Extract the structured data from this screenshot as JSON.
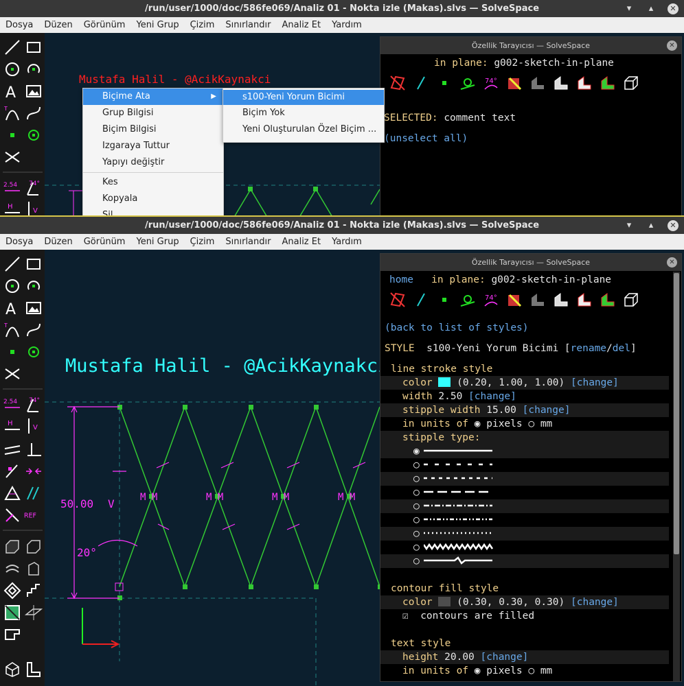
{
  "window_title": "/run/user/1000/doc/586fe069/Analiz 01 - Nokta izle (Makas).slvs — SolveSpace",
  "window_buttons": {
    "minimize": "▾",
    "maximize": "▴",
    "close": "✕"
  },
  "menu": [
    "Dosya",
    "Düzen",
    "Görünüm",
    "Yeni Grup",
    "Çizim",
    "Sınırlandır",
    "Analiz Et",
    "Yardım"
  ],
  "comment_text": "Mustafa Halil - @AcikKaynakci",
  "constraint_labels": {
    "length": "50.00",
    "angle": "20°",
    "vertical": "V",
    "midpoint": "M",
    "ref": "REF",
    "dim": "2.54",
    "deg": "74°",
    "h": "H",
    "v": "V"
  },
  "top": {
    "context_menu": [
      {
        "label": "Biçime Ata",
        "submenu": true
      },
      {
        "label": "Grup Bilgisi"
      },
      {
        "label": "Biçim Bilgisi"
      },
      {
        "label": "Izgaraya Tuttur"
      },
      {
        "label": "Yapıyı değiştir"
      },
      {
        "label": "Kes"
      },
      {
        "label": "Kopyala"
      },
      {
        "label": "Sil"
      }
    ],
    "submenu": [
      "s100-Yeni Yorum Bicimi",
      "Biçim Yok",
      "Yeni Oluşturulan Özel Biçim ..."
    ],
    "inspector": {
      "title": "Özellik Tarayıcısı — SolveSpace",
      "in_plane_label": "in plane:",
      "in_plane_value": "g002-sketch-in-plane",
      "selected_label": "SELECTED:",
      "selected_value": "comment text",
      "unselect": "(unselect all)"
    }
  },
  "bottom": {
    "inspector": {
      "title": "Özellik Tarayıcısı — SolveSpace",
      "home": "home",
      "in_plane_label": "in plane:",
      "in_plane_value": "g002-sketch-in-plane",
      "back": "(back to list of styles)",
      "style_label": "STYLE",
      "style_name": "s100-Yeni Yorum Bicimi",
      "rename": "rename",
      "del": "del",
      "line_stroke_header": "line stroke style",
      "color_label": "color",
      "color_value": "(0.20, 1.00, 1.00)",
      "color_swatch": "#33ffff",
      "change": "[change]",
      "width_label": "width",
      "width_value": "2.50",
      "stipple_width_label": "stipple width",
      "stipple_width_value": "15.00",
      "in_units_of": "in units of",
      "pixels": "pixels",
      "mm": "mm",
      "stipple_type": "stipple type:",
      "stipple_selected_index": 0,
      "contour_header": "contour fill style",
      "fill_color_value": "(0.30, 0.30, 0.30)",
      "fill_swatch": "#4d4d4d",
      "contours_filled": "contours are filled",
      "text_style_header": "text style",
      "height_label": "height",
      "height_value": "20.00"
    }
  },
  "colors": {
    "line": "#33c833",
    "constraint": "#ff33ff",
    "comment_red": "#ff2020",
    "comment_cyan": "#33ffff",
    "construction": "#208080",
    "axis_green": "#22ee22",
    "axis_red": "#ee2020"
  }
}
